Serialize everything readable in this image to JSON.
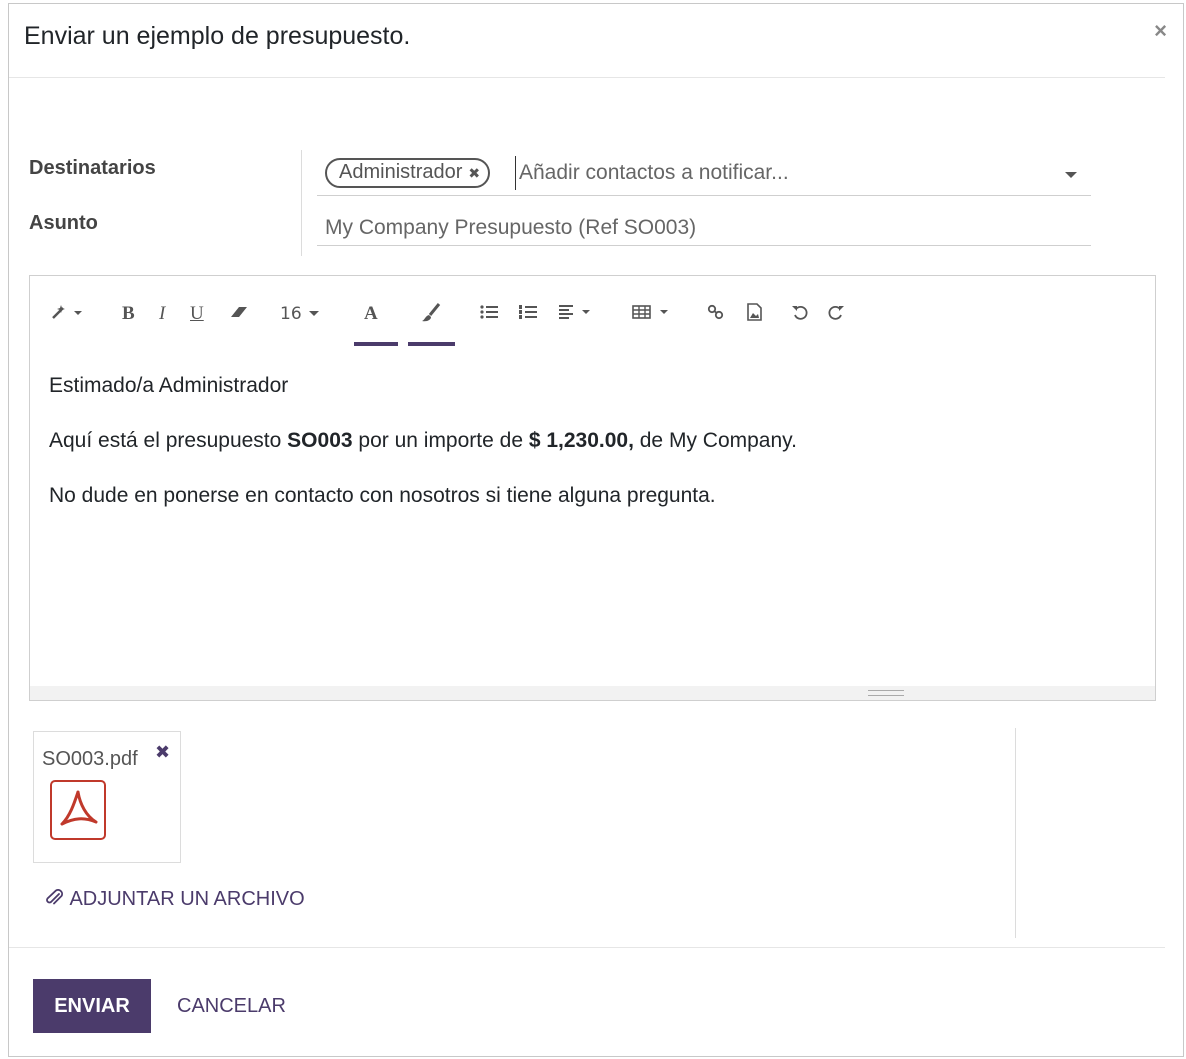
{
  "dialog": {
    "title": "Enviar un ejemplo de presupuesto.",
    "close_icon": "×"
  },
  "form": {
    "recipients_label": "Destinatarios",
    "subject_label": "Asunto",
    "recipient_tag": "Administrador",
    "recipient_tag_remove": "✖",
    "recipients_placeholder": "Añadir contactos a notificar...",
    "subject_value": "My Company Presupuesto (Ref SO003)"
  },
  "toolbar": {
    "style_icon": "magic-wand-icon",
    "bold": "B",
    "italic": "I",
    "underline": "U",
    "font_size": "16",
    "font_color": "A",
    "colors": {
      "accent": "#4b3b6b"
    }
  },
  "editor": {
    "greeting": "Estimado/a Administrador",
    "line2_pre": "Aquí está el presupuesto ",
    "line2_ref": "SO003",
    "line2_mid": " por un importe de ",
    "line2_amount": "$ 1,230.00,",
    "line2_post": " de My Company.",
    "line3": "No dude en ponerse en contacto con nosotros si tiene alguna pregunta."
  },
  "attachments": {
    "file_name": "SO003.pdf",
    "remove_icon": "✖",
    "attach_link": "ADJUNTAR UN ARCHIVO"
  },
  "footer": {
    "send_label": "ENVIAR",
    "cancel_label": "CANCELAR"
  }
}
